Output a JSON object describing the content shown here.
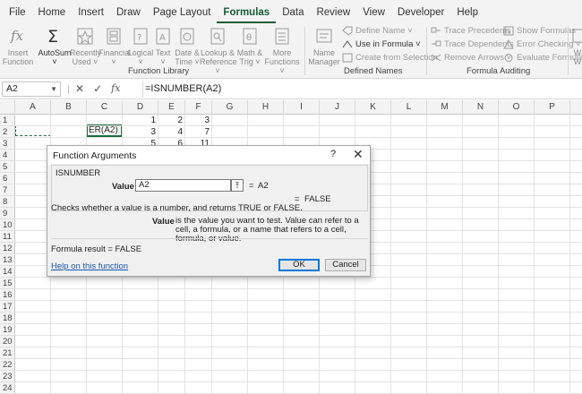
{
  "tabs": [
    "File",
    "Home",
    "Insert",
    "Draw",
    "Page Layout",
    "Formulas",
    "Data",
    "Review",
    "View",
    "Developer",
    "Help"
  ],
  "active_tab": "Formulas",
  "ribbon": {
    "insert_function": {
      "line1": "Insert",
      "line2": "Function"
    },
    "autosum": {
      "line1": "AutoSum",
      "line2": "˅"
    },
    "recently_used": {
      "line1": "Recently",
      "line2": "Used ˅"
    },
    "financial": {
      "line1": "Financial",
      "line2": "˅"
    },
    "logical": {
      "line1": "Logical",
      "line2": "˅"
    },
    "text": {
      "line1": "Text",
      "line2": "˅"
    },
    "date_time": {
      "line1": "Date &",
      "line2": "Time ˅"
    },
    "lookup_reference": {
      "line1": "Lookup &",
      "line2": "Reference ˅"
    },
    "math_trig": {
      "line1": "Math &",
      "line2": "Trig ˅"
    },
    "more_functions": {
      "line1": "More",
      "line2": "Functions ˅"
    },
    "function_library_label": "Function Library",
    "name_manager": {
      "line1": "Name",
      "line2": "Manager"
    },
    "define_name": "Define Name ˅",
    "use_in_formula": "Use in Formula ˅",
    "create_from_selection": "Create from Selection",
    "defined_names_label": "Defined Names",
    "trace_precedents": "Trace Precedents",
    "trace_dependents": "Trace Dependents",
    "remove_arrows": "Remove Arrows ˅",
    "show_formulas": "Show Formulas",
    "error_checking": "Error Checking ˅",
    "evaluate_formula": "Evaluate Formula",
    "formula_auditing_label": "Formula Auditing",
    "watch_window_partial": {
      "line1": "W",
      "line2": "W"
    }
  },
  "formula_bar": {
    "name_box": "A2",
    "fx": "fx",
    "formula": "=ISNUMBER(A2)"
  },
  "columns": [
    "A",
    "B",
    "C",
    "D",
    "E",
    "F",
    "G",
    "H",
    "I",
    "J",
    "K",
    "L",
    "M",
    "N",
    "O",
    "P"
  ],
  "rows": [
    "1",
    "2",
    "3",
    "4",
    "5",
    "6",
    "7",
    "8",
    "9",
    "10",
    "11",
    "12",
    "13",
    "14",
    "15",
    "16",
    "17",
    "18",
    "19",
    "20",
    "21",
    "22",
    "23",
    "24"
  ],
  "cells": {
    "D1": "1",
    "E1": "2",
    "F1": "3",
    "C2": "ER(A2)",
    "D2": "3",
    "E2": "4",
    "F2": "7",
    "D3": "5",
    "E3": "6",
    "F3": "11"
  },
  "dialog": {
    "title": "Function Arguments",
    "help_glyph": "?",
    "close_glyph": "✕",
    "function_name": "ISNUMBER",
    "arg_label": "Value",
    "arg_value": "A2",
    "arg_button": "⤒",
    "arg_eq": "=",
    "arg_result": "A2",
    "result_eq": "=",
    "result_value": "FALSE",
    "description": "Checks whether a value is a number, and returns TRUE or FALSE.",
    "arg_desc_label": "Value",
    "arg_desc": "is the value you want to test. Value can refer to a cell, a formula, or a name that refers to a cell, formula, or value.",
    "formula_result": "Formula result =   FALSE",
    "help_link": "Help on this function",
    "ok": "OK",
    "cancel": "Cancel"
  }
}
